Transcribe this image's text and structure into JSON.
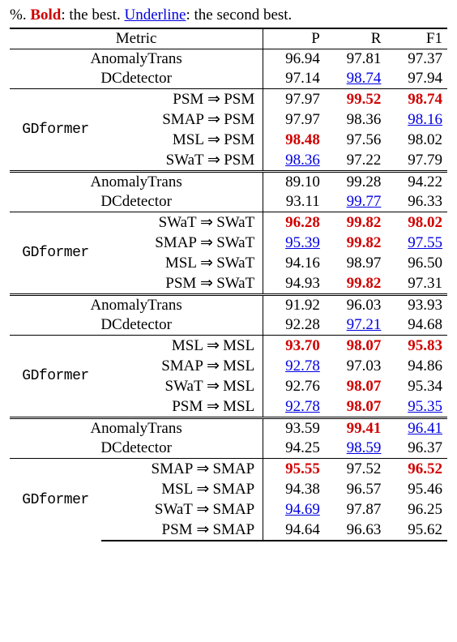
{
  "caption": {
    "pct": "%",
    "dot1": ". ",
    "bold": "Bold",
    "mid": ": the best. ",
    "underline": "Underline",
    "end": ": the second best."
  },
  "header": {
    "metric": "Metric",
    "p": "P",
    "r": "R",
    "f1": "F1"
  },
  "arrow": "⇒",
  "sections": [
    {
      "baselines": [
        {
          "name": "AnomalyTrans",
          "p": "96.94",
          "r": "97.81",
          "f1": "97.37"
        },
        {
          "name": "DCdetector",
          "p": "97.14",
          "r": "98.74",
          "f1": "97.94",
          "style": {
            "r": "u-blue"
          }
        }
      ],
      "model": "GDformer",
      "rows": [
        {
          "from": "PSM",
          "to": "PSM",
          "p": "97.97",
          "r": "99.52",
          "f1": "98.74",
          "style": {
            "r": "bold-red",
            "f1": "bold-red"
          }
        },
        {
          "from": "SMAP",
          "to": "PSM",
          "p": "97.97",
          "r": "98.36",
          "f1": "98.16",
          "style": {
            "f1": "u-blue"
          }
        },
        {
          "from": "MSL",
          "to": "PSM",
          "p": "98.48",
          "r": "97.56",
          "f1": "98.02",
          "style": {
            "p": "bold-red"
          }
        },
        {
          "from": "SWaT",
          "to": "PSM",
          "p": "98.36",
          "r": "97.22",
          "f1": "97.79",
          "style": {
            "p": "u-blue"
          }
        }
      ]
    },
    {
      "baselines": [
        {
          "name": "AnomalyTrans",
          "p": "89.10",
          "r": "99.28",
          "f1": "94.22"
        },
        {
          "name": "DCdetector",
          "p": "93.11",
          "r": "99.77",
          "f1": "96.33",
          "style": {
            "r": "u-blue"
          }
        }
      ],
      "model": "GDformer",
      "rows": [
        {
          "from": "SWaT",
          "to": "SWaT",
          "p": "96.28",
          "r": "99.82",
          "f1": "98.02",
          "style": {
            "p": "bold-red",
            "r": "bold-red",
            "f1": "bold-red"
          }
        },
        {
          "from": "SMAP",
          "to": "SWaT",
          "p": "95.39",
          "r": "99.82",
          "f1": "97.55",
          "style": {
            "p": "u-blue",
            "r": "bold-red",
            "f1": "u-blue"
          }
        },
        {
          "from": "MSL",
          "to": "SWaT",
          "p": "94.16",
          "r": "98.97",
          "f1": "96.50"
        },
        {
          "from": "PSM",
          "to": "SWaT",
          "p": "94.93",
          "r": "99.82",
          "f1": "97.31",
          "style": {
            "r": "bold-red"
          }
        }
      ]
    },
    {
      "baselines": [
        {
          "name": "AnomalyTrans",
          "p": "91.92",
          "r": "96.03",
          "f1": "93.93"
        },
        {
          "name": "DCdetector",
          "p": "92.28",
          "r": "97.21",
          "f1": "94.68",
          "style": {
            "r": "u-blue"
          }
        }
      ],
      "model": "GDformer",
      "rows": [
        {
          "from": "MSL",
          "to": "MSL",
          "p": "93.70",
          "r": "98.07",
          "f1": "95.83",
          "style": {
            "p": "bold-red",
            "r": "bold-red",
            "f1": "bold-red"
          }
        },
        {
          "from": "SMAP",
          "to": "MSL",
          "p": "92.78",
          "r": "97.03",
          "f1": "94.86",
          "style": {
            "p": "u-blue"
          }
        },
        {
          "from": "SWaT",
          "to": "MSL",
          "p": "92.76",
          "r": "98.07",
          "f1": "95.34",
          "style": {
            "r": "bold-red"
          }
        },
        {
          "from": "PSM",
          "to": "MSL",
          "p": "92.78",
          "r": "98.07",
          "f1": "95.35",
          "style": {
            "p": "u-blue",
            "r": "bold-red",
            "f1": "u-blue"
          }
        }
      ]
    },
    {
      "baselines": [
        {
          "name": "AnomalyTrans",
          "p": "93.59",
          "r": "99.41",
          "f1": "96.41",
          "style": {
            "r": "bold-red",
            "f1": "u-blue"
          }
        },
        {
          "name": "DCdetector",
          "p": "94.25",
          "r": "98.59",
          "f1": "96.37",
          "style": {
            "r": "u-blue"
          }
        }
      ],
      "model": "GDformer",
      "rows": [
        {
          "from": "SMAP",
          "to": "SMAP",
          "p": "95.55",
          "r": "97.52",
          "f1": "96.52",
          "style": {
            "p": "bold-red",
            "f1": "bold-red"
          }
        },
        {
          "from": "MSL",
          "to": "SMAP",
          "p": "94.38",
          "r": "96.57",
          "f1": "95.46"
        },
        {
          "from": "SWaT",
          "to": "SMAP",
          "p": "94.69",
          "r": "97.87",
          "f1": "96.25",
          "style": {
            "p": "u-blue"
          }
        },
        {
          "from": "PSM",
          "to": "SMAP",
          "p": "94.64",
          "r": "96.63",
          "f1": "95.62"
        }
      ]
    }
  ]
}
